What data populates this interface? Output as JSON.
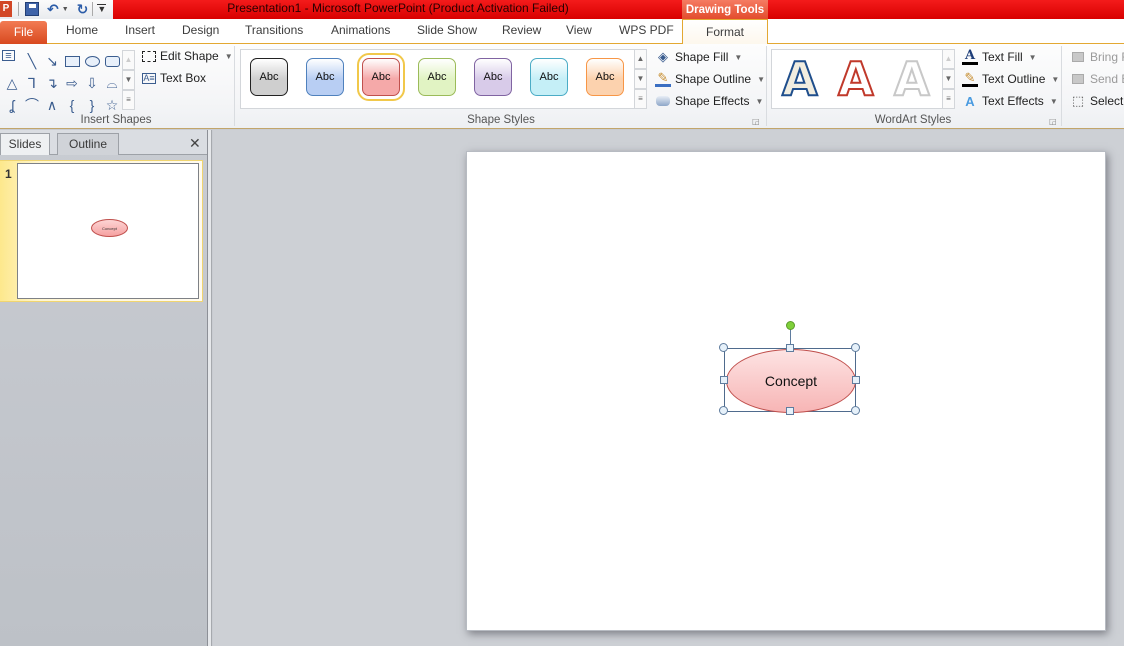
{
  "window": {
    "title": "Presentation1  -  Microsoft PowerPoint (Product Activation Failed)",
    "contextual_tab_group": "Drawing Tools"
  },
  "quick_access": {
    "app_icon": "powerpoint-icon",
    "items": [
      "save-icon",
      "undo-icon",
      "undo-dropdown-icon",
      "redo-icon",
      "customize-qat-icon"
    ]
  },
  "tabs": {
    "file": "File",
    "items": [
      "Home",
      "Insert",
      "Design",
      "Transitions",
      "Animations",
      "Slide Show",
      "Review",
      "View",
      "WPS PDF"
    ],
    "active": "Format"
  },
  "ribbon": {
    "insert_shapes": {
      "label": "Insert Shapes",
      "edit_shape": "Edit Shape",
      "text_box": "Text Box",
      "shapes": [
        "text-box",
        "line",
        "arrow-line",
        "rectangle",
        "oval",
        "rounded-rectangle",
        "triangle",
        "elbow-connector",
        "elbow-arrow-connector",
        "right-arrow",
        "down-arrow",
        "flowchart-shape",
        "freeform",
        "arc",
        "curve",
        "left-brace",
        "right-brace",
        "star"
      ]
    },
    "shape_styles": {
      "label": "Shape Styles",
      "presets": [
        {
          "text": "Abc",
          "fill": "#cfcfcf",
          "border": "#222222",
          "selected": false
        },
        {
          "text": "Abc",
          "fill": "#b8cef3",
          "border": "#4f81bd",
          "selected": false
        },
        {
          "text": "Abc",
          "fill": "#f5a9a9",
          "border": "#c0504d",
          "selected": true
        },
        {
          "text": "Abc",
          "fill": "#e1f3c3",
          "border": "#9bbb59",
          "selected": false
        },
        {
          "text": "Abc",
          "fill": "#d8cbe9",
          "border": "#8064a2",
          "selected": false
        },
        {
          "text": "Abc",
          "fill": "#c5eff7",
          "border": "#4bacc6",
          "selected": false
        },
        {
          "text": "Abc",
          "fill": "#fcd2ae",
          "border": "#f79646",
          "selected": false
        }
      ],
      "shape_fill": "Shape Fill",
      "shape_outline": "Shape Outline",
      "shape_effects": "Shape Effects"
    },
    "wordart_styles": {
      "label": "WordArt Styles",
      "presets": [
        {
          "glyph": "A",
          "fill": "#f1ede0",
          "stroke": "#1f4e8c"
        },
        {
          "glyph": "A",
          "fill": "#ffffff",
          "stroke": "#c0392b"
        },
        {
          "glyph": "A",
          "fill": "#ffffff",
          "stroke": "#c8c8c8"
        }
      ],
      "text_fill": "Text Fill",
      "text_outline": "Text Outline",
      "text_effects": "Text Effects"
    },
    "arrange": {
      "bring_forward": "Bring F",
      "send_backward": "Send B",
      "selection_pane": "Selecti"
    }
  },
  "left_panel": {
    "tabs": [
      "Slides",
      "Outline"
    ],
    "active_tab": "Slides",
    "slides": [
      {
        "number": "1",
        "shape_text": "Concept"
      }
    ]
  },
  "slide": {
    "shape": {
      "type": "ellipse",
      "text": "Concept",
      "fill": "#f7b5b5",
      "border": "#c0504d",
      "selected": true
    }
  },
  "colors": {
    "title_red": "#e00000",
    "file_tab": "#e0572a",
    "accent_gold": "#e3a832"
  }
}
